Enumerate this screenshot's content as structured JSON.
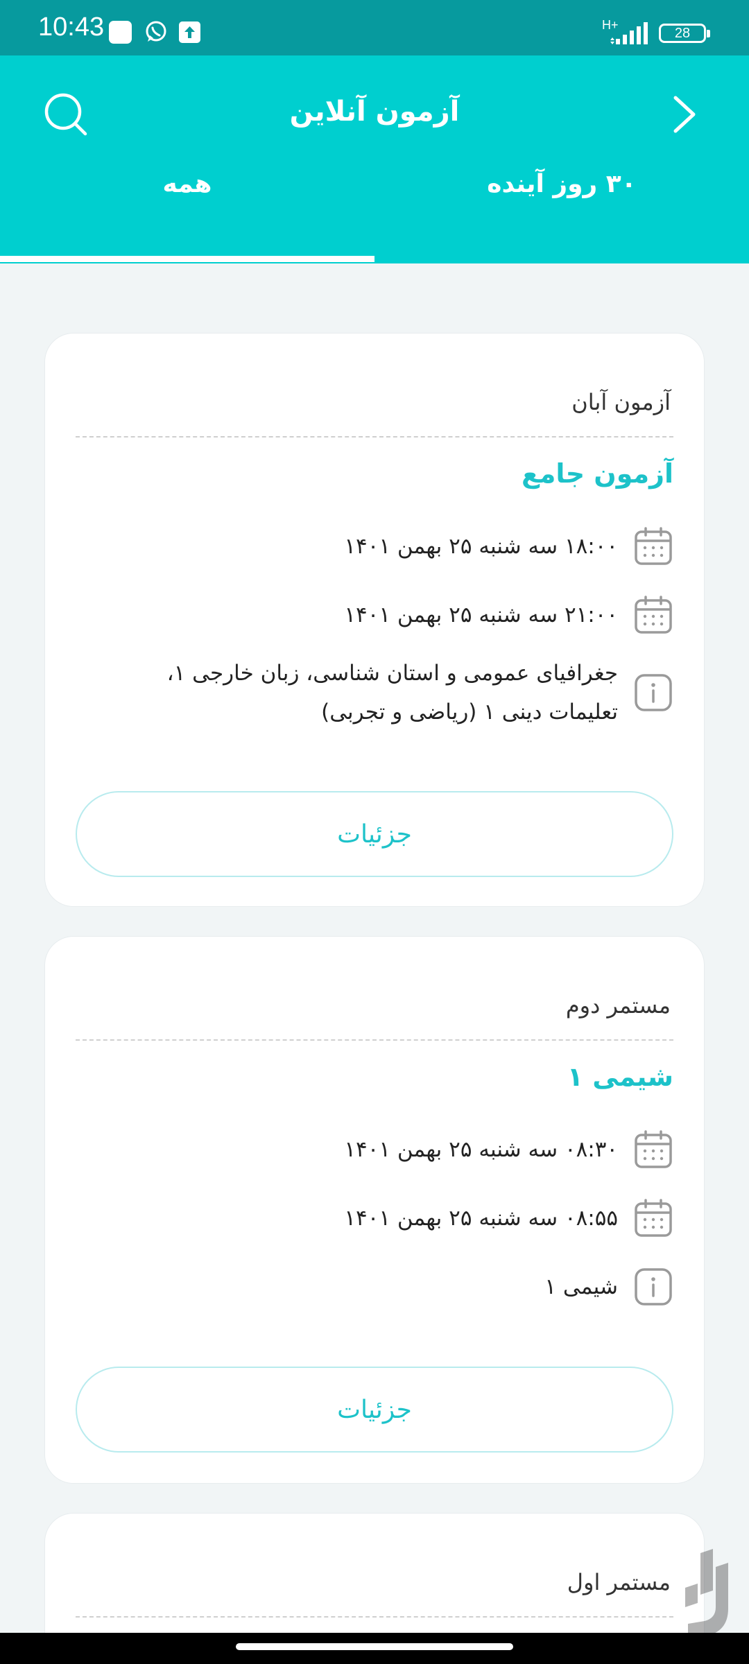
{
  "status_bar": {
    "time": "10:43",
    "network": "H+",
    "battery": "28"
  },
  "header": {
    "title": "آزمون آنلاین"
  },
  "tabs": [
    {
      "label": "همه",
      "selected": true
    },
    {
      "label": "۳۰ روز آینده",
      "selected": false
    }
  ],
  "cards": [
    {
      "subtitle": "آزمون آبان",
      "title": "آزمون جامع",
      "start": "۱۸:۰۰ سه شنبه ۲۵ بهمن ۱۴۰۱",
      "end": "۲۱:۰۰ سه شنبه ۲۵ بهمن ۱۴۰۱",
      "info": "جغرافیای عمومی و استان شناسی، زبان خارجی ۱، تعلیمات دینی ۱ (ریاضی و تجربی)",
      "button": "جزئیات"
    },
    {
      "subtitle": "مستمر دوم",
      "title": "شیمی ۱",
      "start": "۰۸:۳۰ سه شنبه ۲۵ بهمن ۱۴۰۱",
      "end": "۰۸:۵۵ سه شنبه ۲۵ بهمن ۱۴۰۱",
      "info": "شیمی ۱",
      "button": "جزئیات"
    },
    {
      "subtitle": "مستمر اول"
    }
  ],
  "icons": {
    "back": "chevron-right-icon",
    "search": "search-icon",
    "date": "calendar-icon",
    "info": "info-icon"
  },
  "colors": {
    "header": "#00cfcf",
    "status_bar": "#079a9e",
    "accent": "#1dc2c9"
  }
}
